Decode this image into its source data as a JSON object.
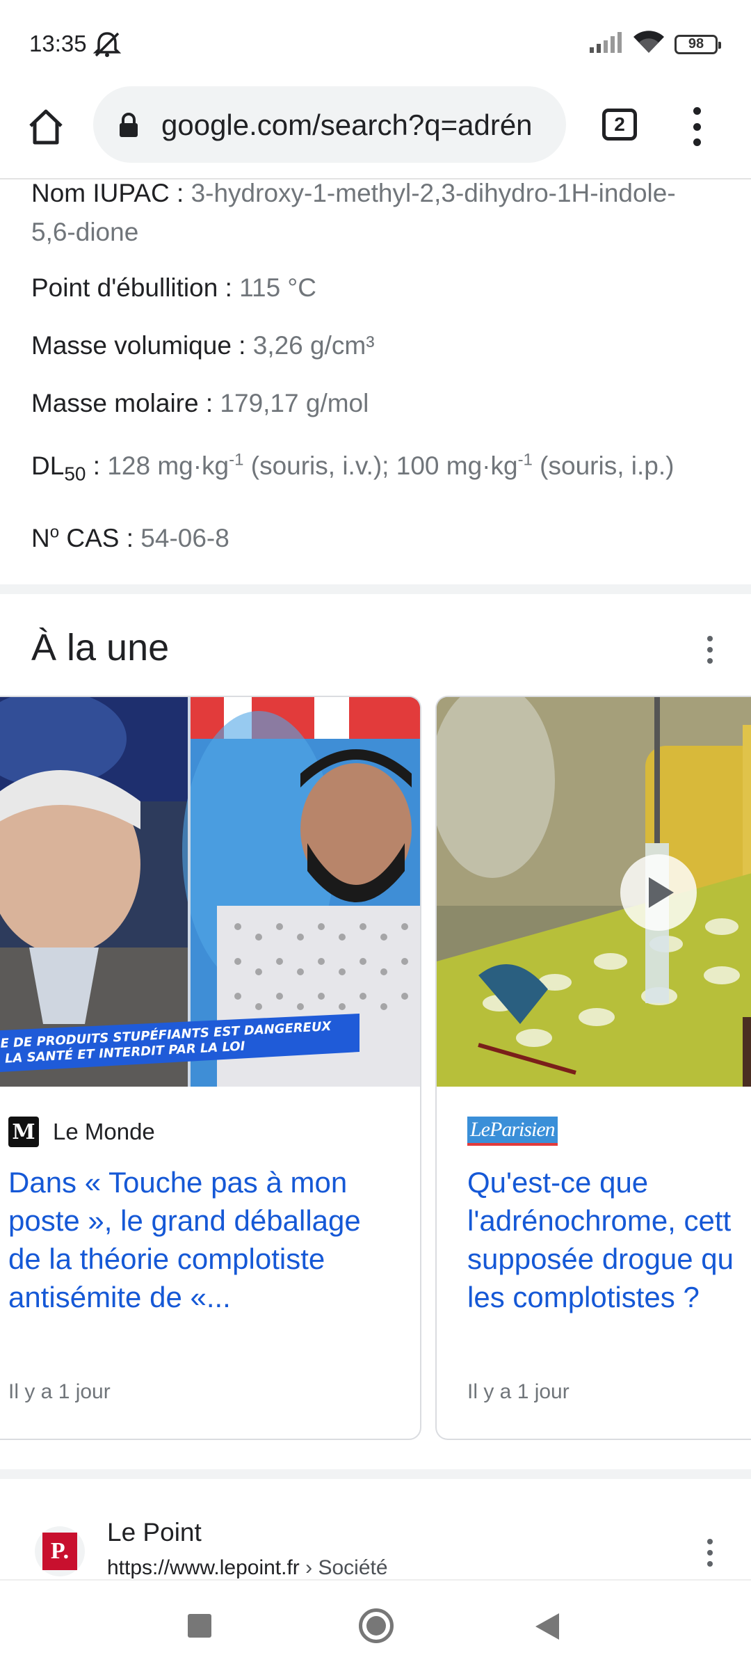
{
  "status_bar": {
    "time": "13:35",
    "battery": "98"
  },
  "toolbar": {
    "url": "google.com/search?q=adrén",
    "tab_count": "2"
  },
  "facts": [
    {
      "key": "Nom IUPAC : ",
      "value": "3-hydroxy-1-methyl-2,3-dihydro-1H-indole-",
      "value_cont": "5,6-dione"
    },
    {
      "key": "Point d'ébullition : ",
      "value": "115 °C"
    },
    {
      "key": "Masse volumique : ",
      "value": "3,26 g/cm³"
    },
    {
      "key": "Masse molaire : ",
      "value": "179,17 g/mol"
    },
    {
      "key_main": "DL",
      "key_sub": "50",
      "key_rest": " : ",
      "v1": "128 mg·kg",
      "v1_sup": "-1",
      "v2": " (souris, i.v.); 100 mg·kg",
      "v2_sup": "-1",
      "v3": " (souris, i.p.)"
    },
    {
      "key_main": "N",
      "key_sup": "o",
      "key_rest": " CAS : ",
      "value": "54-06-8"
    }
  ],
  "top_stories": {
    "title": "À la une",
    "cards": [
      {
        "source": "Le Monde",
        "logo_text": "M",
        "image_banner": "GE DE PRODUITS STUPÉFIANTS EST DANGEREUX\nR LA SANTÉ ET INTERDIT PAR LA LOI",
        "headline": "Dans « Touche pas à mon poste », le grand déballage de la théorie complotiste antisémite de «...",
        "age": "Il y a 1 jour"
      },
      {
        "source": "Le Parisien",
        "logo_text": "LeParisien",
        "headline": "Qu'est-ce que l'adrénochrome, cett supposée drogue qu les complotistes ?",
        "age": "Il y a 1 jour",
        "has_video": true
      }
    ]
  },
  "result": {
    "name": "Le Point",
    "url": "https://www.lepoint.fr",
    "breadcrumb": " › Société",
    "logo_text": "P."
  },
  "icons": [
    "mute-icon",
    "signal-icon",
    "wifi-icon",
    "home-icon",
    "lock-icon",
    "more-vert-icon",
    "play-icon"
  ]
}
